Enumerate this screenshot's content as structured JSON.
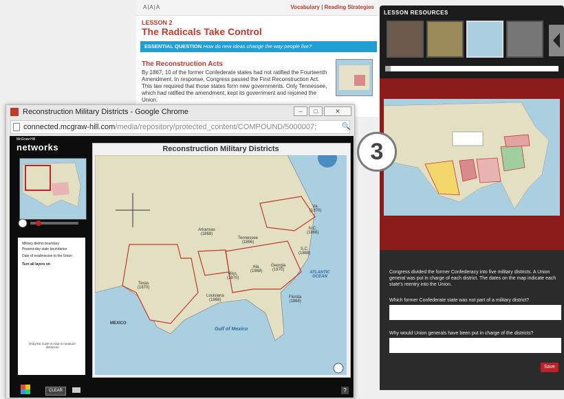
{
  "lesson": {
    "toolbar": {
      "text_tools": "A|A|A",
      "links": "Vocabulary | Reading Strategies"
    },
    "label": "LESSON 2",
    "title": "The Radicals Take Control",
    "essential_question_label": "ESSENTIAL QUESTION",
    "essential_question": "How do new ideas change the way people live?",
    "section_title": "The Reconstruction Acts",
    "section_text": "By 1867, 10 of the former Confederate states had not ratified the Fourteenth Amendment. In response, Congress passed the First Reconstruction Act. This law required that those states form new governments. Only Tennessee, which had ratified the amendment, kept its government and rejoined the Union."
  },
  "resources": {
    "header": "LESSON RESOURCES",
    "intro": "Congress divided the former Confederacy into five military districts. A Union general was put in charge of each district. The dates on the map indicate each state's reentry into the Union.",
    "question1": "Which former Confederate state was not part of a military district?",
    "answer1": "",
    "question2": "Why would Union generals have been put in charge of the districts?",
    "answer2": "",
    "save_label": "Save"
  },
  "step_badge": "3",
  "chrome": {
    "title": "Reconstruction Military Districts - Google Chrome",
    "url_host": "connected.mcgraw-hill.com",
    "url_path": "/media/repository/protected_content/COMPOUND/5000007;"
  },
  "app": {
    "brand_small": "McGraw-Hill",
    "brand": "networks",
    "map_title": "Reconstruction Military Districts",
    "legend": {
      "items": [
        "Military district boundary",
        "Present-day state boundaries",
        "Date of readmission to the Union",
        "Turn all layers on"
      ],
      "scale_text": "Drag the scale to map to measure distances"
    },
    "clear_label": "CLEAR",
    "help_label": "?",
    "map_labels": {
      "texas": "Texas",
      "texas_year": "(1870)",
      "arkansas": "Arkansas",
      "arkansas_year": "(1868)",
      "louisiana": "Louisiana",
      "louisiana_year": "(1868)",
      "miss": "Miss.",
      "miss_year": "(1870)",
      "ala": "Ala.",
      "ala_year": "(1868)",
      "georgia": "Georgia",
      "georgia_year": "(1870)",
      "florida": "Florida",
      "florida_year": "(1868)",
      "sc": "S.C.",
      "sc_year": "(1868)",
      "nc": "N.C.",
      "nc_year": "(1868)",
      "va": "Va.",
      "va_year": "(1870)",
      "tennessee": "Tennessee",
      "tennessee_year": "(1866)",
      "mexico": "MEXICO",
      "atlantic": "ATLANTIC OCEAN",
      "gulf": "Gulf of Mexico"
    }
  }
}
